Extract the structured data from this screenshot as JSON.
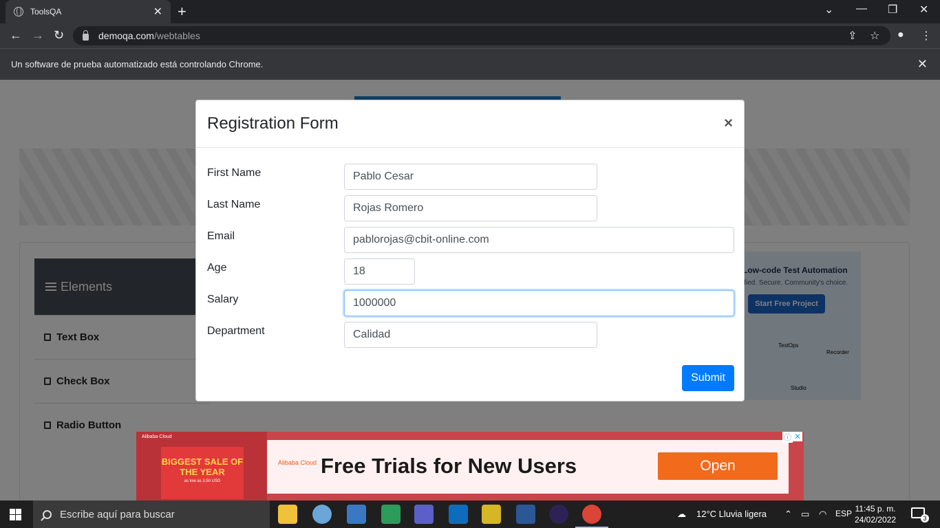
{
  "browser": {
    "tab_title": "ToolsQA",
    "url_host": "demoqa.com",
    "url_path": "/webtables",
    "infobar_text": "Un software de prueba automatizado está controlando Chrome."
  },
  "page": {
    "sidebar": {
      "header": "Elements",
      "items": [
        {
          "label": "Text Box"
        },
        {
          "label": "Check Box"
        },
        {
          "label": "Radio Button"
        }
      ]
    },
    "side_ad": {
      "title": "Low-code Test Automation",
      "subtitle": "ified. Secure. Community's choice.",
      "button": "Start Free Project",
      "labels": [
        "TestOps",
        "Recorder",
        "Studio"
      ]
    }
  },
  "modal": {
    "title": "Registration Form",
    "close_label": "×",
    "fields": [
      {
        "label": "First Name",
        "value": "Pablo Cesar"
      },
      {
        "label": "Last Name",
        "value": "Rojas Romero"
      },
      {
        "label": "Email",
        "value": "pablorojas@cbit-online.com"
      },
      {
        "label": "Age",
        "value": "18"
      },
      {
        "label": "Salary",
        "value": "1000000"
      },
      {
        "label": "Department",
        "value": "Calidad"
      }
    ],
    "submit_label": "Submit"
  },
  "bottom_ad": {
    "brand": "Alibaba Cloud",
    "sale_text": "BIGGEST SALE OF THE YEAR",
    "sale_small": "as low as 3.50 USD",
    "headline": "Free Trials for New Users",
    "open_label": "Open"
  },
  "taskbar": {
    "search_placeholder": "Escribe aquí para buscar",
    "weather": "12°C  Lluvia ligera",
    "lang": "ESP",
    "time": "11:45 p. m.",
    "date": "24/02/2022",
    "notifications": "3"
  }
}
